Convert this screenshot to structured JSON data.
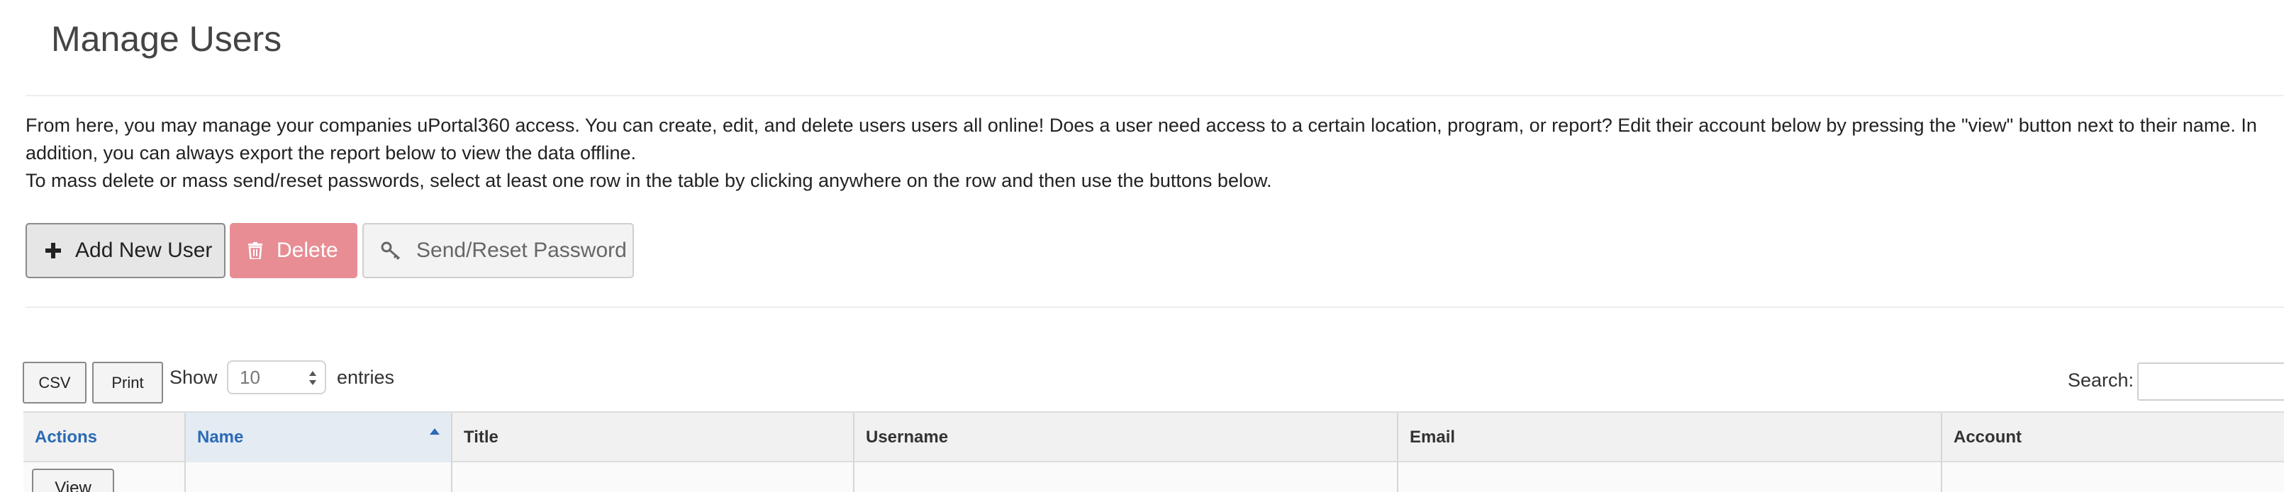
{
  "page": {
    "title": "Manage Users",
    "intro_line1": "From here, you may manage your companies uPortal360 access. You can create, edit, and delete users users all online! Does a user need access to a certain location, program, or report? Edit their account below by pressing the \"view\" button next to their name. In addition, you can always export the report below to view the data offline.",
    "intro_line2": "To mass delete or mass send/reset passwords, select at least one row in the table by clicking anywhere on the row and then use the buttons below."
  },
  "actions": {
    "add_label": "Add New User",
    "add_icon": "plus-icon",
    "delete_label": "Delete",
    "delete_icon": "trash-icon",
    "reset_label": "Send/Reset Password",
    "reset_icon": "key-icon"
  },
  "table_controls": {
    "csv_label": "CSV",
    "print_label": "Print",
    "show_label": "Show",
    "page_length": "10",
    "entries_label": "entries",
    "search_label": "Search:",
    "search_value": ""
  },
  "table": {
    "columns": [
      "Actions",
      "Name",
      "Title",
      "Username",
      "Email",
      "Account"
    ],
    "sorted_column": "Name",
    "sort_direction": "ascending",
    "rows": [
      {
        "action_label": "View"
      }
    ]
  },
  "colors": {
    "link_blue": "#2a6ab4",
    "delete_red": "#e88d94",
    "sorted_header_bg": "#e4ebf3"
  }
}
